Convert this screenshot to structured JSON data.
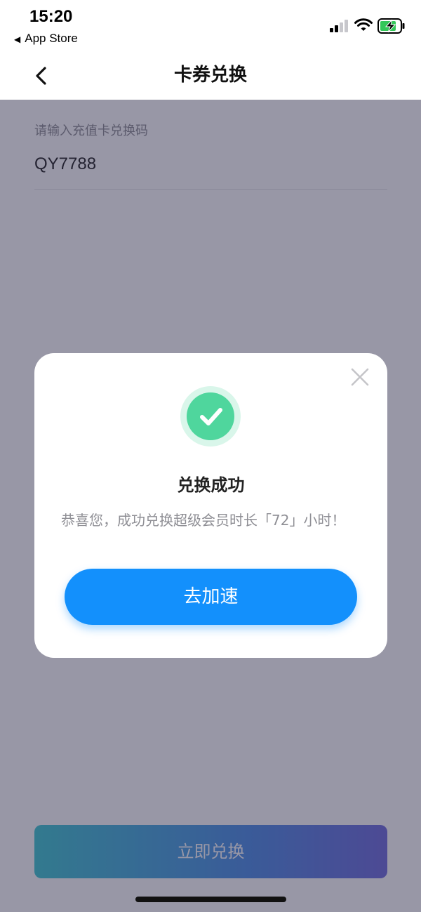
{
  "status_bar": {
    "time": "15:20",
    "back_app": "App Store"
  },
  "nav": {
    "title": "卡券兑换",
    "back_icon": "chevron-left-icon"
  },
  "form": {
    "label": "请输入充值卡兑换码",
    "code_value": "QY7788"
  },
  "actions": {
    "redeem_label": "立即兑换"
  },
  "modal": {
    "title": "兑换成功",
    "message": "恭喜您，成功兑换超级会员时长「72」小时！",
    "button_label": "去加速",
    "close_icon": "close-icon",
    "success_icon": "check-circle-icon"
  },
  "colors": {
    "accent": "#1390fc",
    "success": "#4fd69d"
  }
}
